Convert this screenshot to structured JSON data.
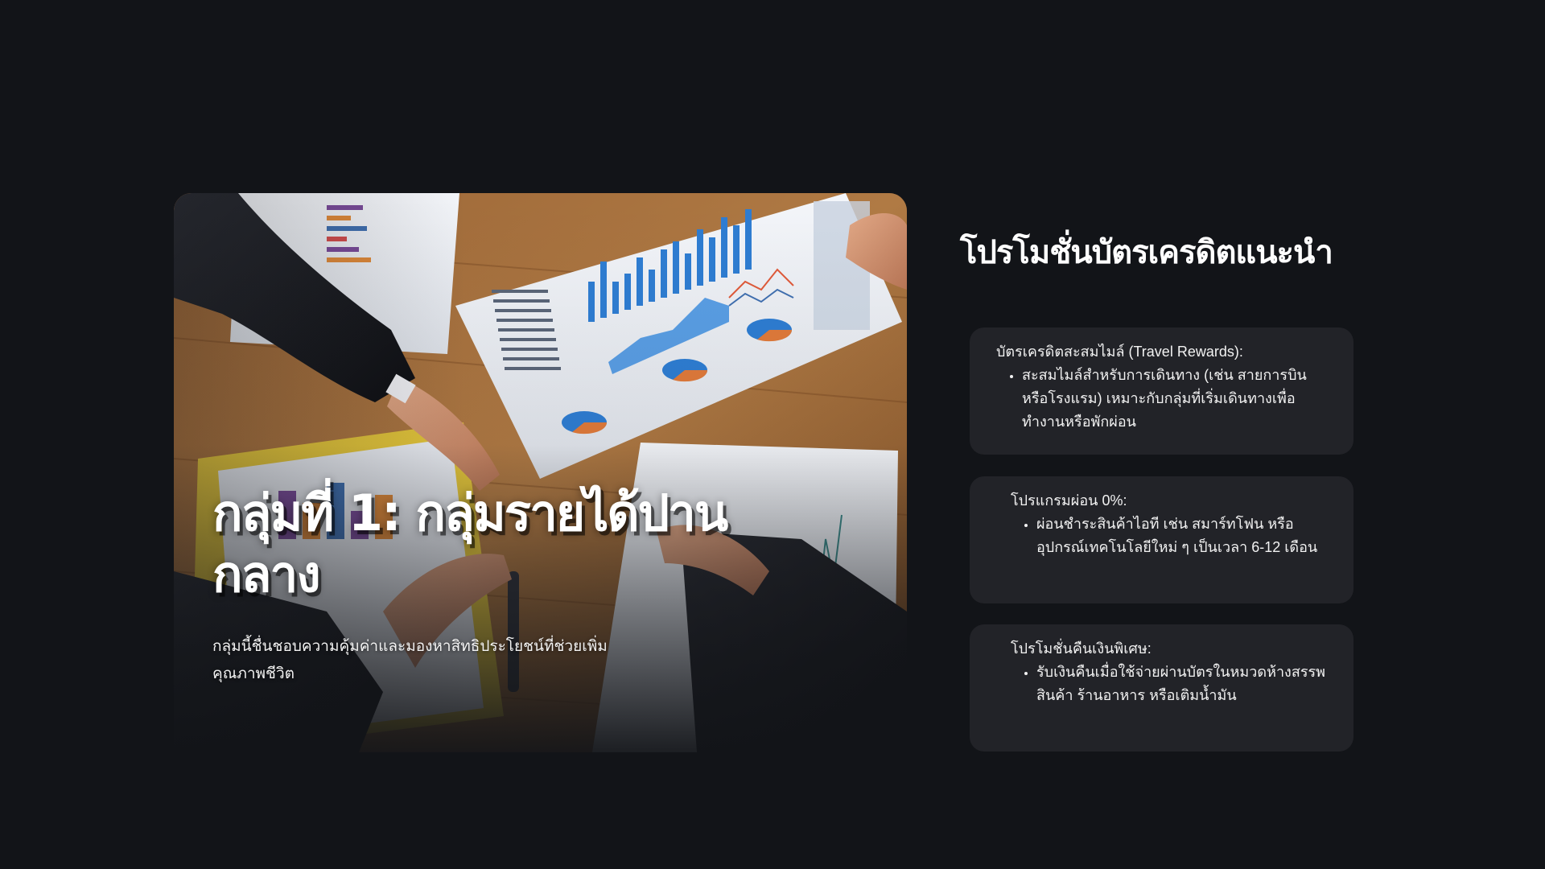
{
  "hero": {
    "title": "กลุ่มที่ 1: กลุ่มรายได้ปานกลาง",
    "subtitle": "กลุ่มนี้ชื่นชอบความคุ้มค่าและมองหาสิทธิประโยชน์ที่ช่วยเพิ่มคุณภาพชีวิต"
  },
  "section": {
    "title": "โปรโมชั่นบัตรเครดิตแนะนำ"
  },
  "cards": [
    {
      "heading": "บัตรเครดิตสะสมไมล์ (Travel Rewards):",
      "bullet": "สะสมไมล์สำหรับการเดินทาง (เช่น สายการบินหรือโรงแรม) เหมาะกับกลุ่มที่เริ่มเดินทางเพื่อทำงานหรือพักผ่อน"
    },
    {
      "heading": "โปรแกรมผ่อน 0%:",
      "bullet": "ผ่อนชำระสินค้าไอที เช่น สมาร์ทโฟน หรืออุปกรณ์เทคโนโลยีใหม่ ๆ เป็นเวลา 6-12 เดือน"
    },
    {
      "heading": "โปรโมชั่นคืนเงินพิเศษ:",
      "bullet": "รับเงินคืนเมื่อใช้จ่ายผ่านบัตรในหมวดห้างสรรพสินค้า ร้านอาหาร หรือเติมน้ำมัน"
    }
  ],
  "colors": {
    "background": "#121418",
    "card": "#222328",
    "text": "#ffffff"
  }
}
